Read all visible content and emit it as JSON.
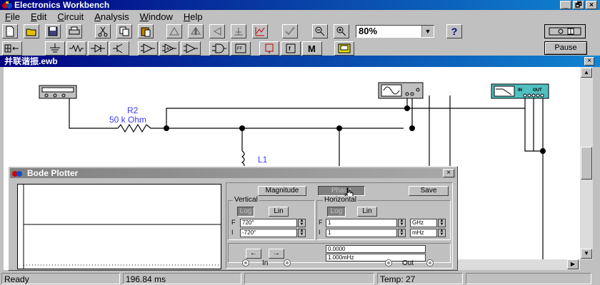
{
  "app": {
    "title": "Electronics Workbench"
  },
  "window_controls": {
    "minimize": "_",
    "restore": "🗗",
    "close": "×"
  },
  "menu": [
    {
      "pre": "",
      "ul": "F",
      "post": "ile"
    },
    {
      "pre": "",
      "ul": "E",
      "post": "dit"
    },
    {
      "pre": "",
      "ul": "C",
      "post": "ircuit"
    },
    {
      "pre": "",
      "ul": "A",
      "post": "nalysis"
    },
    {
      "pre": "",
      "ul": "W",
      "post": "indow"
    },
    {
      "pre": "",
      "ul": "H",
      "post": "elp"
    }
  ],
  "toolbar": {
    "zoom": "80%",
    "zoom_drop": "▼",
    "help": "?",
    "pause": "Pause"
  },
  "document": {
    "title": "并联谐振.ewb",
    "close": "×"
  },
  "circuit": {
    "r2_name": "R2",
    "r2_value": "50 k Ohm",
    "l1_name": "L1",
    "bode_in": "IN",
    "bode_out": "OUT"
  },
  "bode": {
    "title": "Bode Plotter",
    "close": "×",
    "magnitude": "Magnitude",
    "phase": "Phase",
    "save": "Save",
    "vertical": "Vertical",
    "horizontal": "Horizontal",
    "log": "Log",
    "lin": "Lin",
    "f_label": "F",
    "i_label": "I",
    "v_f_value": "720°",
    "v_i_value": "-720°",
    "h_f_value": "1",
    "h_i_value": "1",
    "h_f_unit": "GHz",
    "h_i_unit": "mHz",
    "readout1": "0.0000",
    "readout2": "1.000mHz",
    "left_arrow": "←",
    "right_arrow": "→",
    "in_label": "In",
    "out_label": "Out"
  },
  "status": {
    "ready": "Ready",
    "time": "196.84 ms",
    "temp": "Temp:  27"
  },
  "colors": {
    "titlebar": "#000080",
    "component_text": "#3a3aff"
  }
}
